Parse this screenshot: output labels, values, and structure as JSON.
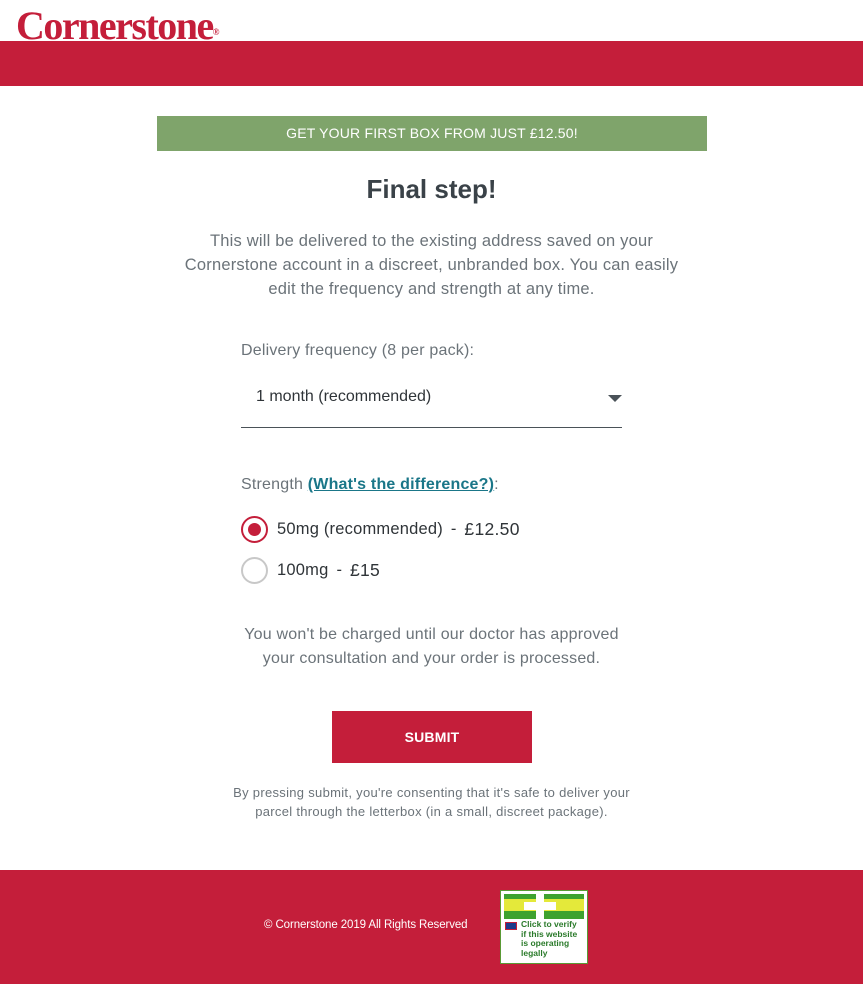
{
  "header": {
    "logo_text": "Cornerstone",
    "logo_mark": "®"
  },
  "promo": {
    "text": "GET YOUR FIRST BOX FROM JUST £12.50!"
  },
  "main": {
    "title": "Final step!",
    "intro": "This will be delivered to the existing address saved on your Cornerstone account in a discreet, unbranded box. You can easily edit the frequency and strength at any time.",
    "frequency": {
      "label": "Delivery frequency (8 per pack):",
      "selected": "1 month (recommended)"
    },
    "strength": {
      "label": "Strength",
      "link": "(What's the difference?)",
      "suffix": ":",
      "options": [
        {
          "label": "50mg (recommended)",
          "separator": "-",
          "price": "£12.50",
          "selected": true
        },
        {
          "label": "100mg",
          "separator": "-",
          "price": "£15",
          "selected": false
        }
      ]
    },
    "charge_note": "You won't be charged until our doctor has approved your consultation and your order is processed.",
    "submit_label": "SUBMIT",
    "consent": "By pressing submit, you're consenting that it's safe to deliver your parcel through the letterbox (in a small, discreet package)."
  },
  "footer": {
    "copyright": "© Cornerstone 2019 All Rights Reserved",
    "badge_text": "Click to verify\nif this website\nis operating\nlegally"
  },
  "colors": {
    "brand_red": "#c41e3a",
    "promo_green": "#7fa46b",
    "link_teal": "#1a7688"
  }
}
